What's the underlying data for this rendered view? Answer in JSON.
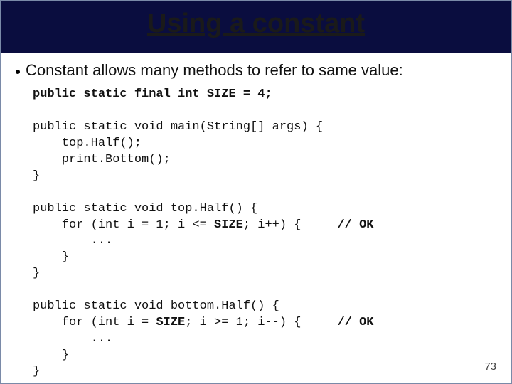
{
  "slide": {
    "title": "Using a constant",
    "bullet": "Constant allows many methods to refer to same value:",
    "page_number": "73"
  },
  "code": {
    "decl_a": "public static final int ",
    "decl_b": "SIZE",
    "decl_c": " = 4;",
    "blank": "",
    "main1": "public static void main(String[] args) {",
    "main2": "    top.Half();",
    "main3": "    print.Bottom();",
    "main4": "}",
    "top1": "public static void top.Half() {",
    "top2a": "    for (int i = 1; i <= ",
    "top2b": "SIZE",
    "top2c": "; i++) {     ",
    "top2d": "// OK",
    "top3": "        ...",
    "top4": "    }",
    "top5": "}",
    "bot1": "public static void bottom.Half() {",
    "bot2a": "    for (int i = ",
    "bot2b": "SIZE",
    "bot2c": "; i >= 1; i--) {     ",
    "bot2d": "// OK",
    "bot3": "        ...",
    "bot4": "    }",
    "bot5": "}"
  }
}
